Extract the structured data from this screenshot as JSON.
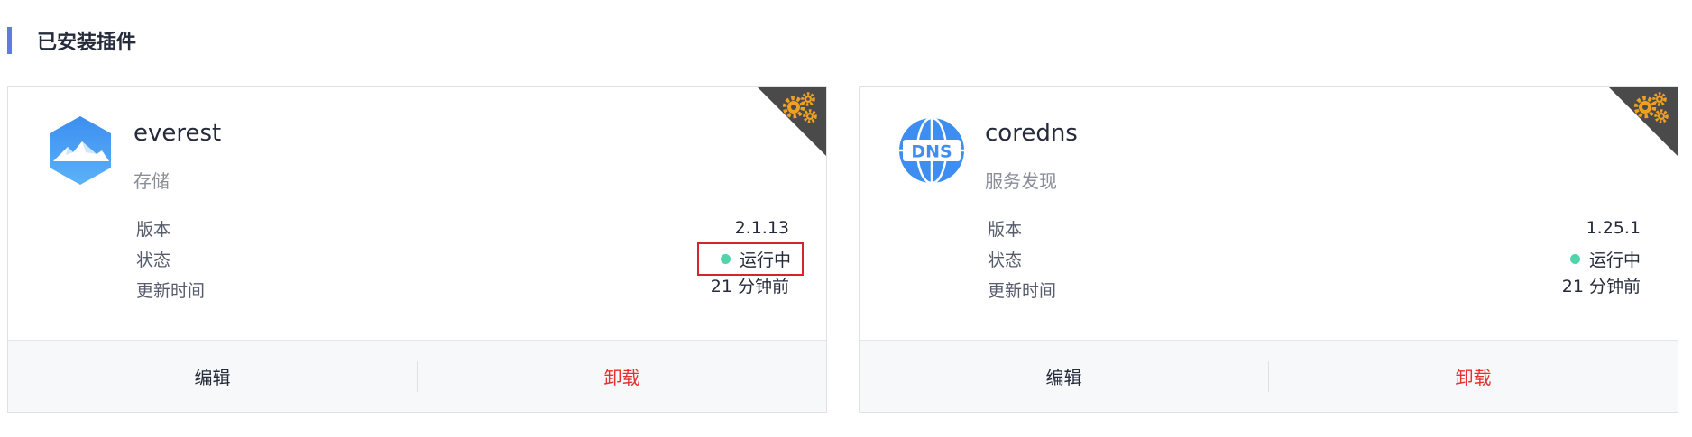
{
  "section": {
    "title": "已安装插件"
  },
  "colors": {
    "accent": "#5e7ce0",
    "status_running": "#50d4ab",
    "danger": "#e6312d",
    "highlight_box": "#d4242e",
    "corner_badge": "#4a4a4a",
    "gear": "#f0a020"
  },
  "plugins": [
    {
      "name": "everest",
      "category": "存储",
      "icon": "mountain-hexagon-icon",
      "corner_icon": "gears-icon",
      "version_label": "版本",
      "version_value": "2.1.13",
      "status_label": "状态",
      "status_value": "运行中",
      "status_highlighted": true,
      "updated_label": "更新时间",
      "updated_value": "21 分钟前",
      "edit_label": "编辑",
      "uninstall_label": "卸载"
    },
    {
      "name": "coredns",
      "category": "服务发现",
      "icon": "dns-globe-icon",
      "logo_text": "DNS",
      "corner_icon": "gears-icon",
      "version_label": "版本",
      "version_value": "1.25.1",
      "status_label": "状态",
      "status_value": "运行中",
      "status_highlighted": false,
      "updated_label": "更新时间",
      "updated_value": "21 分钟前",
      "edit_label": "编辑",
      "uninstall_label": "卸载"
    }
  ]
}
